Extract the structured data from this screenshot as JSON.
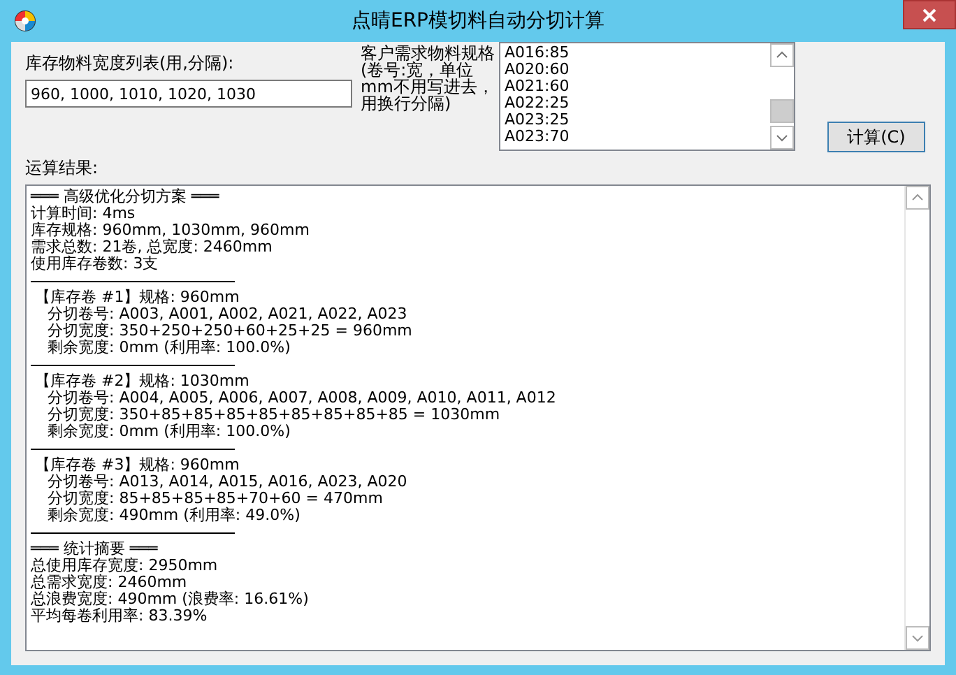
{
  "window": {
    "title": "点晴ERP模切料自动分切计算"
  },
  "stock_widths": {
    "label": "库存物料宽度列表(用,分隔):",
    "value": "960, 1000, 1010, 1020, 1030"
  },
  "demand": {
    "label": "客户需求物料规格(卷号:宽，单位mm不用写进去，用换行分隔)",
    "lines": [
      "A016:85",
      "A020:60",
      "A021:60",
      "A022:25",
      "A023:25",
      "A023:70"
    ]
  },
  "calculate_button": {
    "label": "计算(C)"
  },
  "result": {
    "label": "运算结果:",
    "lines": [
      {
        "kind": "heading",
        "text": "═══ 高级优化分切方案 ═══"
      },
      {
        "kind": "text",
        "text": "计算时间: 4ms"
      },
      {
        "kind": "text",
        "text": "库存规格: 960mm, 1030mm, 960mm"
      },
      {
        "kind": "text",
        "text": "需求总数: 21卷, 总宽度: 2460mm"
      },
      {
        "kind": "text",
        "text": "使用库存卷数: 3支"
      },
      {
        "kind": "rule"
      },
      {
        "kind": "roll",
        "text": "【库存卷 #1】规格: 960mm"
      },
      {
        "kind": "detail",
        "text": "分切卷号: A003, A001, A002, A021, A022, A023"
      },
      {
        "kind": "detail",
        "text": "分切宽度: 350+250+250+60+25+25 = 960mm"
      },
      {
        "kind": "detail",
        "text": "剩余宽度: 0mm (利用率: 100.0%)"
      },
      {
        "kind": "rule"
      },
      {
        "kind": "roll",
        "text": "【库存卷 #2】规格: 1030mm"
      },
      {
        "kind": "detail",
        "text": "分切卷号: A004, A005, A006, A007, A008, A009, A010, A011, A012"
      },
      {
        "kind": "detail",
        "text": "分切宽度: 350+85+85+85+85+85+85+85+85 = 1030mm"
      },
      {
        "kind": "detail",
        "text": "剩余宽度: 0mm (利用率: 100.0%)"
      },
      {
        "kind": "rule"
      },
      {
        "kind": "roll",
        "text": "【库存卷 #3】规格: 960mm"
      },
      {
        "kind": "detail",
        "text": "分切卷号: A013, A014, A015, A016, A023, A020"
      },
      {
        "kind": "detail",
        "text": "分切宽度: 85+85+85+85+70+60 = 470mm"
      },
      {
        "kind": "detail",
        "text": "剩余宽度: 490mm (利用率: 49.0%)"
      },
      {
        "kind": "rule"
      },
      {
        "kind": "heading",
        "text": "═══ 统计摘要 ═══"
      },
      {
        "kind": "text",
        "text": "总使用库存宽度: 2950mm"
      },
      {
        "kind": "text",
        "text": "总需求宽度: 2460mm"
      },
      {
        "kind": "text",
        "text": "总浪费宽度: 490mm (浪费率: 16.61%)"
      },
      {
        "kind": "text",
        "text": "平均每卷利用率: 83.39%"
      }
    ]
  }
}
